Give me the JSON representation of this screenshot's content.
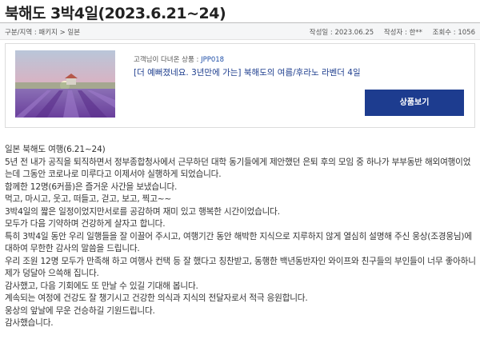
{
  "post": {
    "title": "북해도 3박4일(2023.6.21~24)"
  },
  "meta": {
    "category": "구분/지역 : 패키지 > 일본",
    "date": "작성일 : 2023.06.25",
    "author": "작성자 : 한**",
    "views": "조회수 : 1056"
  },
  "product_card": {
    "caption_prefix": "고객님이 다녀온 상품 :",
    "product_code": "JPP018",
    "product_title": "[더 예뻐졌네요. 3년만에 가는] 북해도의 여름/후라노 라벤더 4일",
    "view_button_label": "상품보기",
    "image_icon": "lavender-field-photo"
  },
  "review": {
    "lines": [
      "일본 북해도 여행(6.21~24)",
      "5년 전 내가 공직을 퇴직하면서 정부종합청사에서 근무하던 대학 동기들에게 제안했던 은퇴 후의 모임 중 하나가 부부동반 해외여행이었는데 그동안 코로나로 미루다고 이제서야 실행하게 되었습니다.",
      "함께한 12명(6커플)은 즐거운 사간을 보냈습니다.",
      "먹고, 마시고, 웃고, 떠들고, 걷고, 보고, 찍고~~",
      "3박4일의 짧은 일정이었지만서로를 공감하며 재미 있고 행복한 시간이었습니다.",
      "모두가 다음 기약하며 건강하게 살자고 합니다.",
      "특히 3박4일 동안 우리 일행들을 잘 이끌어 주시고, 여행기간 동안 해박한 지식으로 지루하지 않게 열심히 설명해 주신 웅상(조경웅님)에 대하여 무한한 감사의 말씀을 드립니다.",
      "우리 조원 12명 모두가 만족해 하고 여행사 컨택 등 잘 했다고 칭찬받고, 동행한 백년동반자인 와이프와 친구들의 부인들이 너무 좋아하니 제가 덩달아 으쓱해 집니다.",
      "감사했고, 다음 기회에도 또 만날 수 있길 기대해 봅니다.",
      "계속되는 여정에 건강도 잘 챙기시고 건강한 의식과 지식의 전달자로서 적극 응원합니다.",
      "웅상의 앞날에 무운 건승하길 기원드립니다.",
      "감사했습니다."
    ]
  },
  "colors": {
    "accent": "#1d3c8f",
    "link": "#1f4fa8",
    "meta_bg": "#f5f6f7"
  }
}
